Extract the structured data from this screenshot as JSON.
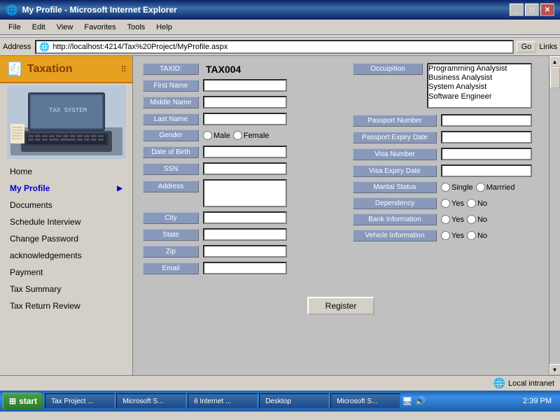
{
  "window": {
    "title": "My Profile - Microsoft Internet Explorer",
    "icon": "🌐"
  },
  "menubar": {
    "items": [
      "File",
      "Edit",
      "View",
      "Favorites",
      "Tools",
      "Help"
    ]
  },
  "addressbar": {
    "label": "Address",
    "url": "http://localhost:4214/Tax%20Project/MyProfile.aspx",
    "go_label": "Go",
    "links_label": "Links"
  },
  "sidebar": {
    "title": "Taxation",
    "nav_items": [
      {
        "label": "Home",
        "arrow": false
      },
      {
        "label": "My Profile",
        "arrow": true,
        "active": true
      },
      {
        "label": "Documents",
        "arrow": false
      },
      {
        "label": "Schedule Interview",
        "arrow": false
      },
      {
        "label": "Change Password",
        "arrow": false
      },
      {
        "label": "acknowledgements",
        "arrow": false
      },
      {
        "label": "Payment",
        "arrow": false
      },
      {
        "label": "Tax Summary",
        "arrow": false
      },
      {
        "label": "Tax Return Review",
        "arrow": false
      }
    ]
  },
  "form": {
    "taxid_label": "TAXID:",
    "taxid_value": "TAX004",
    "fields_left": [
      {
        "label": "First Name",
        "type": "text",
        "value": ""
      },
      {
        "label": "Middle Name",
        "type": "text",
        "value": ""
      },
      {
        "label": "Last Name",
        "type": "text",
        "value": ""
      },
      {
        "label": "Gender",
        "type": "radio",
        "options": [
          "Male",
          "Female"
        ]
      },
      {
        "label": "Date of Birth",
        "type": "text",
        "value": ""
      },
      {
        "label": "SSN",
        "type": "text",
        "value": ""
      },
      {
        "label": "Address",
        "type": "textarea",
        "value": ""
      },
      {
        "label": "City",
        "type": "text",
        "value": ""
      },
      {
        "label": "State",
        "type": "text",
        "value": ""
      },
      {
        "label": "Zip",
        "type": "text",
        "value": ""
      },
      {
        "label": "Email",
        "type": "text",
        "value": ""
      }
    ],
    "occupation_label": "Occuipition",
    "occupation_options": [
      "Programming Analysist",
      "Business Analysist",
      "System Analysist",
      "Software Engineer"
    ],
    "fields_right": [
      {
        "label": "Passport Number",
        "type": "text",
        "value": ""
      },
      {
        "label": "Passport Expiry Date",
        "type": "text",
        "value": ""
      },
      {
        "label": "Visa Number",
        "type": "text",
        "value": ""
      },
      {
        "label": "Visa Expiry Date",
        "type": "text",
        "value": ""
      },
      {
        "label": "Marital Status",
        "type": "radio",
        "options": [
          "Single",
          "Marrried"
        ]
      },
      {
        "label": "Dependency",
        "type": "radio",
        "options": [
          "Yes",
          "No"
        ]
      },
      {
        "label": "Bank Information",
        "type": "radio",
        "options": [
          "Yes",
          "No"
        ]
      },
      {
        "label": "Vehicle Information",
        "type": "radio",
        "options": [
          "Yes",
          "No"
        ]
      }
    ],
    "register_button": "Register"
  },
  "statusbar": {
    "status": "",
    "zone": "Local intranet"
  },
  "taskbar": {
    "start": "start",
    "items": [
      "Tax Project ...",
      "Microsoft S...",
      "6 Internet ...",
      "Desktop",
      "Microsoft S..."
    ],
    "clock": "2:39 PM"
  }
}
